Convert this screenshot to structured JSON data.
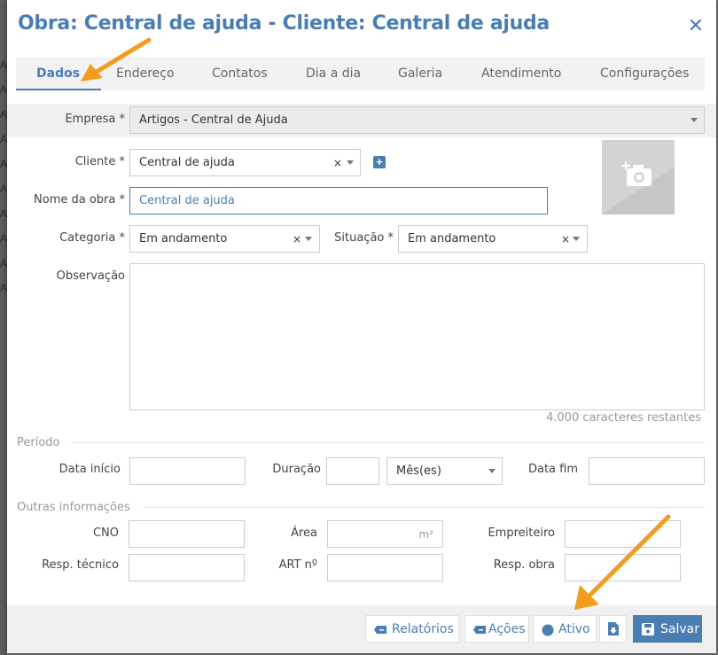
{
  "modal": {
    "title": "Obra: Central de ajuda - Cliente: Central de ajuda",
    "close_icon": "close-icon"
  },
  "tabs": [
    {
      "label": "Dados",
      "active": true
    },
    {
      "label": "Endereço"
    },
    {
      "label": "Contatos"
    },
    {
      "label": "Dia a dia"
    },
    {
      "label": "Galeria"
    },
    {
      "label": "Atendimento"
    },
    {
      "label": "Configurações"
    }
  ],
  "form": {
    "empresa_label": "Empresa *",
    "empresa_value": "Artigos - Central de Ajuda",
    "cliente_label": "Cliente *",
    "cliente_value": "Central de ajuda",
    "nome_label": "Nome da obra *",
    "nome_value": "Central de ajuda",
    "categoria_label": "Categoria *",
    "categoria_value": "Em andamento",
    "situacao_label": "Situação *",
    "situacao_value": "Em andamento",
    "observacao_label": "Observação",
    "observacao_value": "",
    "chars_remaining": "4.000  caracteres restantes",
    "clear_symbol": "×"
  },
  "periodo": {
    "section": "Período",
    "data_inicio_label": "Data início",
    "data_inicio_value": "",
    "duracao_label": "Duração",
    "duracao_value": "",
    "duracao_unit": "Mês(es)",
    "data_fim_label": "Data fim",
    "data_fim_value": ""
  },
  "outras": {
    "section": "Outras informações",
    "cno_label": "CNO",
    "area_label": "Área",
    "area_suffix": "m²",
    "empreiteiro_label": "Empreiteiro",
    "resp_tecnico_label": "Resp. técnico",
    "art_label": "ART nº",
    "resp_obra_label": "Resp. obra"
  },
  "footer": {
    "relatorios": "Relatórios",
    "acoes": "Ações",
    "ativo": "Ativo",
    "salvar": "Salvar"
  },
  "colors": {
    "accent": "#4a7eb3",
    "annotation_arrow": "#f39c1f"
  }
}
